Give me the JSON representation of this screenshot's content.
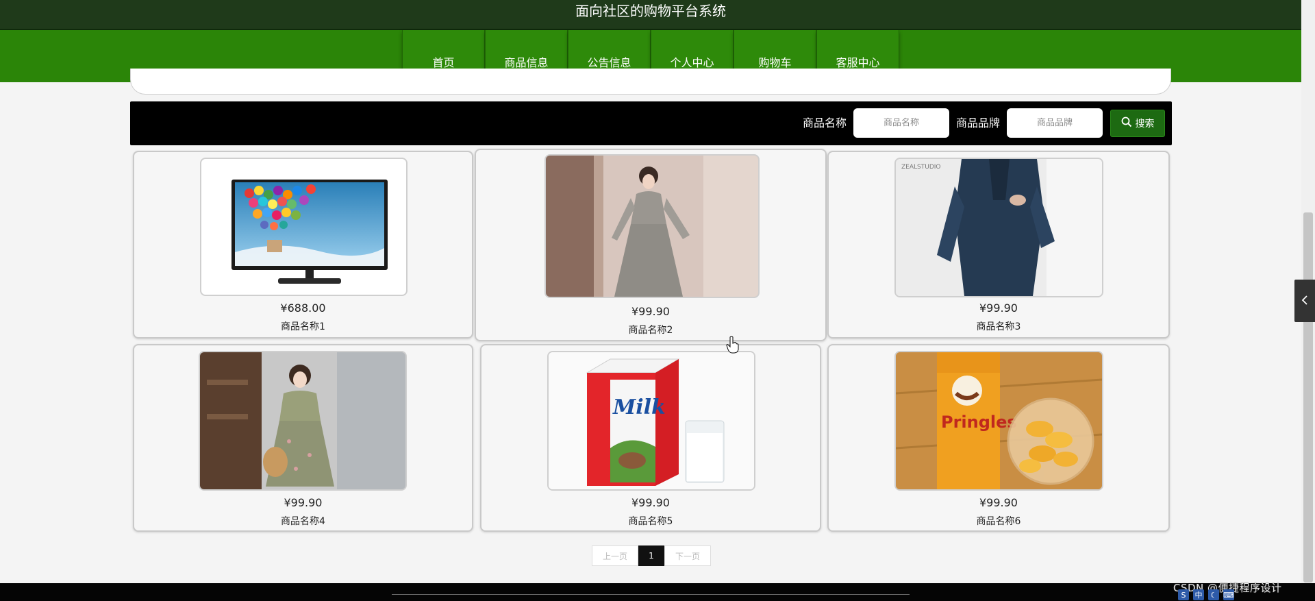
{
  "header": {
    "title": "面向社区的购物平台系统"
  },
  "nav": {
    "items": [
      {
        "label": "首页"
      },
      {
        "label": "商品信息"
      },
      {
        "label": "公告信息"
      },
      {
        "label": "个人中心"
      },
      {
        "label": "购物车"
      },
      {
        "label": "客服中心"
      }
    ]
  },
  "search": {
    "name_label": "商品名称",
    "name_placeholder": "商品名称",
    "brand_label": "商品品牌",
    "brand_placeholder": "商品品牌",
    "button_label": "搜索"
  },
  "products": [
    {
      "price": "¥688.00",
      "name": "商品名称1",
      "image": "tv-monitor"
    },
    {
      "price": "¥99.90",
      "name": "商品名称2",
      "image": "woman-gray-dress"
    },
    {
      "price": "¥99.90",
      "name": "商品名称3",
      "image": "man-navy-suit",
      "image_text": "ZEALSTUDIO"
    },
    {
      "price": "¥99.90",
      "name": "商品名称4",
      "image": "woman-floral-dress"
    },
    {
      "price": "¥99.90",
      "name": "商品名称5",
      "image": "milk-carton",
      "image_text": "Milk"
    },
    {
      "price": "¥99.90",
      "name": "商品名称6",
      "image": "pringles-chips",
      "image_text": "Pringles"
    }
  ],
  "pagination": {
    "prev_label": "上一页",
    "current": "1",
    "next_label": "下一页"
  },
  "watermark": "CSDN @便捷程序设计",
  "tray": {
    "ime_label": "中"
  },
  "colors": {
    "nav_green": "#2b8508",
    "title_bar": "#1f3a1a",
    "search_button": "#1d6a12"
  }
}
